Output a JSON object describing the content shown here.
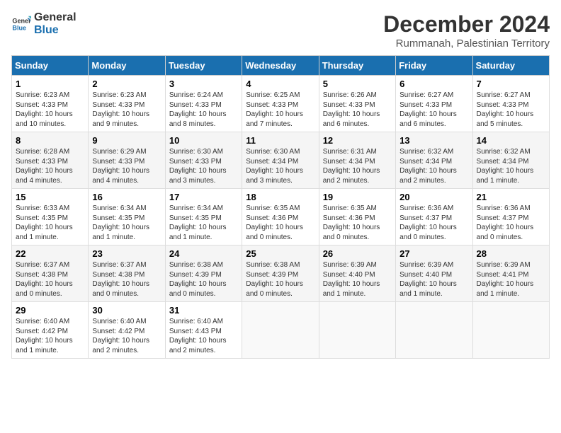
{
  "logo": {
    "general": "General",
    "blue": "Blue"
  },
  "title": "December 2024",
  "subtitle": "Rummanah, Palestinian Territory",
  "days_of_week": [
    "Sunday",
    "Monday",
    "Tuesday",
    "Wednesday",
    "Thursday",
    "Friday",
    "Saturday"
  ],
  "weeks": [
    [
      {
        "day": "1",
        "sunrise": "6:23 AM",
        "sunset": "4:33 PM",
        "daylight": "10 hours and 10 minutes."
      },
      {
        "day": "2",
        "sunrise": "6:23 AM",
        "sunset": "4:33 PM",
        "daylight": "10 hours and 9 minutes."
      },
      {
        "day": "3",
        "sunrise": "6:24 AM",
        "sunset": "4:33 PM",
        "daylight": "10 hours and 8 minutes."
      },
      {
        "day": "4",
        "sunrise": "6:25 AM",
        "sunset": "4:33 PM",
        "daylight": "10 hours and 7 minutes."
      },
      {
        "day": "5",
        "sunrise": "6:26 AM",
        "sunset": "4:33 PM",
        "daylight": "10 hours and 6 minutes."
      },
      {
        "day": "6",
        "sunrise": "6:27 AM",
        "sunset": "4:33 PM",
        "daylight": "10 hours and 6 minutes."
      },
      {
        "day": "7",
        "sunrise": "6:27 AM",
        "sunset": "4:33 PM",
        "daylight": "10 hours and 5 minutes."
      }
    ],
    [
      {
        "day": "8",
        "sunrise": "6:28 AM",
        "sunset": "4:33 PM",
        "daylight": "10 hours and 4 minutes."
      },
      {
        "day": "9",
        "sunrise": "6:29 AM",
        "sunset": "4:33 PM",
        "daylight": "10 hours and 4 minutes."
      },
      {
        "day": "10",
        "sunrise": "6:30 AM",
        "sunset": "4:33 PM",
        "daylight": "10 hours and 3 minutes."
      },
      {
        "day": "11",
        "sunrise": "6:30 AM",
        "sunset": "4:34 PM",
        "daylight": "10 hours and 3 minutes."
      },
      {
        "day": "12",
        "sunrise": "6:31 AM",
        "sunset": "4:34 PM",
        "daylight": "10 hours and 2 minutes."
      },
      {
        "day": "13",
        "sunrise": "6:32 AM",
        "sunset": "4:34 PM",
        "daylight": "10 hours and 2 minutes."
      },
      {
        "day": "14",
        "sunrise": "6:32 AM",
        "sunset": "4:34 PM",
        "daylight": "10 hours and 1 minute."
      }
    ],
    [
      {
        "day": "15",
        "sunrise": "6:33 AM",
        "sunset": "4:35 PM",
        "daylight": "10 hours and 1 minute."
      },
      {
        "day": "16",
        "sunrise": "6:34 AM",
        "sunset": "4:35 PM",
        "daylight": "10 hours and 1 minute."
      },
      {
        "day": "17",
        "sunrise": "6:34 AM",
        "sunset": "4:35 PM",
        "daylight": "10 hours and 1 minute."
      },
      {
        "day": "18",
        "sunrise": "6:35 AM",
        "sunset": "4:36 PM",
        "daylight": "10 hours and 0 minutes."
      },
      {
        "day": "19",
        "sunrise": "6:35 AM",
        "sunset": "4:36 PM",
        "daylight": "10 hours and 0 minutes."
      },
      {
        "day": "20",
        "sunrise": "6:36 AM",
        "sunset": "4:37 PM",
        "daylight": "10 hours and 0 minutes."
      },
      {
        "day": "21",
        "sunrise": "6:36 AM",
        "sunset": "4:37 PM",
        "daylight": "10 hours and 0 minutes."
      }
    ],
    [
      {
        "day": "22",
        "sunrise": "6:37 AM",
        "sunset": "4:38 PM",
        "daylight": "10 hours and 0 minutes."
      },
      {
        "day": "23",
        "sunrise": "6:37 AM",
        "sunset": "4:38 PM",
        "daylight": "10 hours and 0 minutes."
      },
      {
        "day": "24",
        "sunrise": "6:38 AM",
        "sunset": "4:39 PM",
        "daylight": "10 hours and 0 minutes."
      },
      {
        "day": "25",
        "sunrise": "6:38 AM",
        "sunset": "4:39 PM",
        "daylight": "10 hours and 0 minutes."
      },
      {
        "day": "26",
        "sunrise": "6:39 AM",
        "sunset": "4:40 PM",
        "daylight": "10 hours and 1 minute."
      },
      {
        "day": "27",
        "sunrise": "6:39 AM",
        "sunset": "4:40 PM",
        "daylight": "10 hours and 1 minute."
      },
      {
        "day": "28",
        "sunrise": "6:39 AM",
        "sunset": "4:41 PM",
        "daylight": "10 hours and 1 minute."
      }
    ],
    [
      {
        "day": "29",
        "sunrise": "6:40 AM",
        "sunset": "4:42 PM",
        "daylight": "10 hours and 1 minute."
      },
      {
        "day": "30",
        "sunrise": "6:40 AM",
        "sunset": "4:42 PM",
        "daylight": "10 hours and 2 minutes."
      },
      {
        "day": "31",
        "sunrise": "6:40 AM",
        "sunset": "4:43 PM",
        "daylight": "10 hours and 2 minutes."
      },
      null,
      null,
      null,
      null
    ]
  ]
}
